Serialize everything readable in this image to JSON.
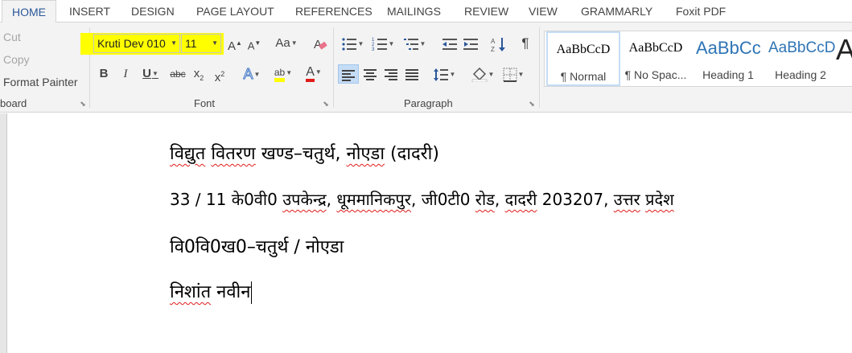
{
  "tabs": [
    "HOME",
    "INSERT",
    "DESIGN",
    "PAGE LAYOUT",
    "REFERENCES",
    "MAILINGS",
    "REVIEW",
    "VIEW",
    "GRAMMARLY",
    "Foxit PDF"
  ],
  "active_tab": "HOME",
  "clipboard": {
    "cut": "Cut",
    "copy": "Copy",
    "format_painter": "Format Painter",
    "label": "board"
  },
  "font": {
    "name": "Kruti Dev 010",
    "size": "11",
    "grow": "A",
    "shrink": "A",
    "change_case": "Aa",
    "bold": "B",
    "italic": "I",
    "underline": "U",
    "strikethrough": "abc",
    "subscript": "x",
    "subscript_mark": "2",
    "superscript": "x",
    "superscript_mark": "2",
    "text_effects": "A",
    "highlight": "ab",
    "font_color": "A",
    "label": "Font",
    "highlight_color": "#ffff00",
    "font_color_value": "#e21b1b"
  },
  "paragraph": {
    "label": "Paragraph",
    "show_marks": "¶"
  },
  "styles": [
    {
      "sample": "AaBbCcD",
      "name": "¶ Normal",
      "selected": true
    },
    {
      "sample": "AaBbCcD",
      "name": "¶ No Spac...",
      "selected": false
    },
    {
      "sample": "AaBbCc",
      "name": "Heading 1",
      "selected": false
    },
    {
      "sample": "AaBbCcD",
      "name": "Heading 2",
      "selected": false
    }
  ],
  "style_more": "A",
  "document": {
    "lines": [
      [
        "विद्युत",
        " ",
        "वितरण",
        " खण्ड–चतुर्थ, ",
        "नोएडा",
        " (दादरी)"
      ],
      [
        "33 / 11  के0वी0  ",
        "उपकेन्द्र",
        ",  ",
        "धूममानिकपुर",
        ",  जी0टी0  ",
        "रोड",
        ",  ",
        "दादरी",
        "  203207,  ",
        "उत्तर",
        "  ",
        "प्रदेश"
      ],
      [
        "वि0वि0ख0–चतुर्थ / नोएडा"
      ],
      [
        "निशांत",
        "  नवीन"
      ]
    ]
  },
  "colors": {
    "accent": "#2b579a",
    "ribbon_bg": "#f3f3f3",
    "spell_squiggle": "#e21b1b",
    "selected_button": "#c5dcf5"
  }
}
